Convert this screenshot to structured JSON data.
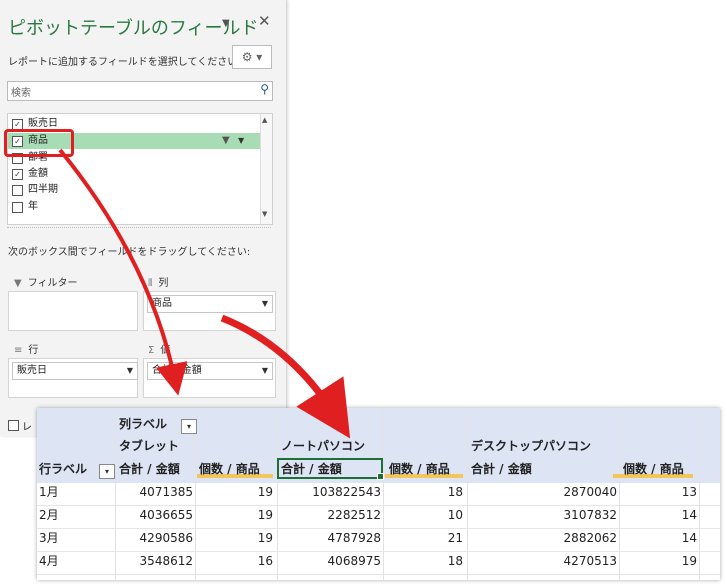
{
  "pane": {
    "title": "ピボットテーブルのフィールド",
    "subtitle": "レポートに追加するフィールドを選択してください:",
    "search_placeholder": "検索",
    "fields": [
      {
        "label": "販売日",
        "checked": true
      },
      {
        "label": "商品",
        "checked": true
      },
      {
        "label": "部署",
        "checked": false
      },
      {
        "label": "金額",
        "checked": true
      },
      {
        "label": "四半期",
        "checked": false
      },
      {
        "label": "年",
        "checked": false
      }
    ],
    "drag_hint": "次のボックス間でフィールドをドラッグしてください:",
    "areas": {
      "filter": {
        "label": "フィルター"
      },
      "columns": {
        "label": "列",
        "chip": "商品"
      },
      "rows": {
        "label": "行",
        "chip": "販売日"
      },
      "values": {
        "label": "値",
        "chip": "合計 / 金額"
      }
    },
    "bottom_checkbox_label": "レ"
  },
  "icons": {
    "dropdown": "chevron-down-icon",
    "close": "close-icon",
    "gear": "gear-icon",
    "search": "search-icon",
    "funnel": "funnel-icon",
    "filter_area": "filter-icon",
    "columns_area": "columns-icon",
    "rows_area": "rows-icon",
    "values_area": "sigma-icon"
  },
  "colors": {
    "accent_green": "#2a7a3f",
    "field_highlight": "#a8dcb4",
    "pivot_header": "#dde4f4",
    "annotation_red": "#e02020",
    "highlight_yellow": "#f4c65a"
  },
  "pivot": {
    "col_labels": "列ラベル",
    "row_labels": "行ラベル",
    "groups": [
      "タブレット",
      "ノートパソコン",
      "デスクトップパソコン"
    ],
    "measure_sum": "合計 / 金額",
    "measure_count": "個数 / 商品",
    "rows": [
      {
        "label": "1月",
        "values": [
          "4071385",
          "19",
          "103822543",
          "18",
          "2870040",
          "13"
        ]
      },
      {
        "label": "2月",
        "values": [
          "4036655",
          "19",
          "2282512",
          "10",
          "3107832",
          "14"
        ]
      },
      {
        "label": "3月",
        "values": [
          "4290586",
          "19",
          "4787928",
          "21",
          "2882062",
          "14"
        ]
      },
      {
        "label": "4月",
        "values": [
          "3548612",
          "16",
          "4068975",
          "18",
          "4270513",
          "19"
        ]
      }
    ]
  }
}
